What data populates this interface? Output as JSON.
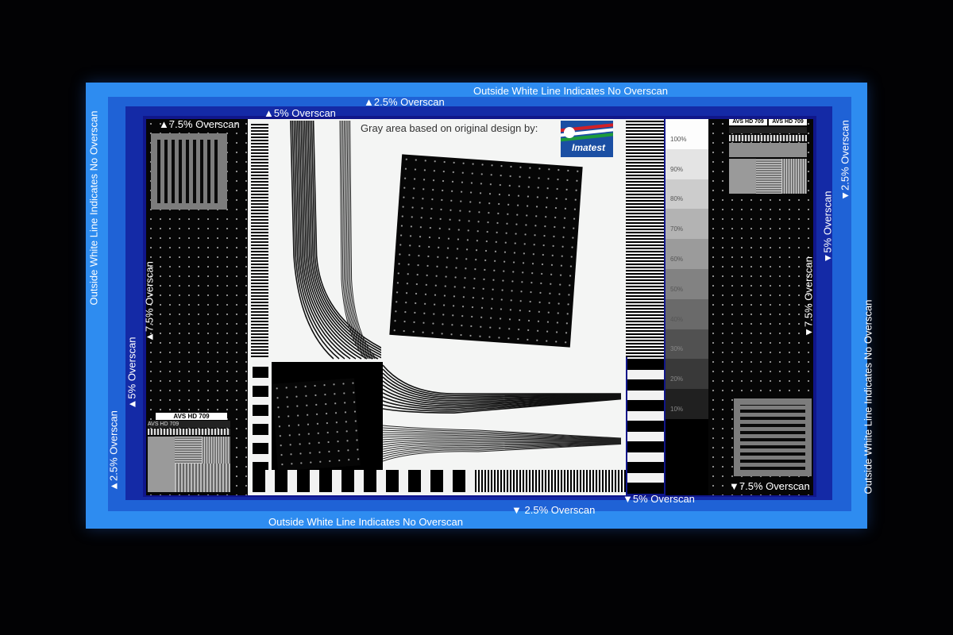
{
  "labels": {
    "no_overscan": "Outside White Line Indicates No Overscan",
    "overscan_2_5": "2.5% Overscan",
    "overscan_5": "5% Overscan",
    "overscan_7_5": "7.5% Overscan",
    "up_arrow": "▲",
    "down_arrow": "▼"
  },
  "credit": {
    "text": "Gray area based on original design by:",
    "logo_text": "Imatest"
  },
  "brand_tags": {
    "avs": "AVS HD 709"
  },
  "gray_scale": {
    "steps": [
      "100%",
      "90%",
      "80%",
      "70%",
      "60%",
      "50%",
      "40%",
      "30%",
      "20%",
      "10%"
    ],
    "levels": [
      1.0,
      0.9,
      0.8,
      0.7,
      0.6,
      0.5,
      0.4,
      0.3,
      0.2,
      0.1
    ]
  },
  "colors": {
    "outer_blue": "#2e8cf0",
    "band_2_5": "#1f62d6",
    "band_5": "#142aa6",
    "band_7_5": "#10168a",
    "logo_blue": "#1b4fa3",
    "logo_red": "#d22027",
    "logo_green": "#1d9b3a"
  }
}
